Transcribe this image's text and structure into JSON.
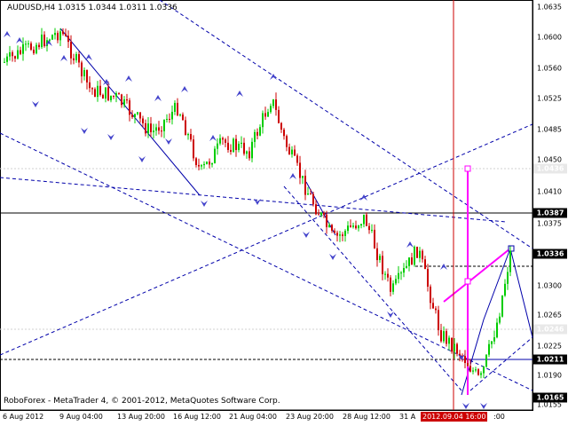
{
  "header": {
    "symbol_info": "AUDUSD,H4  1.0315 1.0344 1.0311 1.0336"
  },
  "footer": {
    "copyright": "RoboForex - MetaTrader 4, © 2001-2012, MetaQuotes Software Corp."
  },
  "price_axis": {
    "labels": [
      "1.0635",
      "1.0600",
      "1.0560",
      "1.0525",
      "1.0485",
      "1.0450",
      "1.0410",
      "1.0375",
      "1.0300",
      "1.0265",
      "1.0225",
      "1.0190",
      "1.0155"
    ],
    "tags": {
      "level_black": "1.0387",
      "current": "1.0336",
      "support": "1.0211",
      "low": "1.0165",
      "gray_upper": "1.0436",
      "gray_lower": "1.0246"
    }
  },
  "time_axis": {
    "labels": [
      "6 Aug 2012",
      "9 Aug 04:00",
      "13 Aug 20:00",
      "16 Aug 12:00",
      "21 Aug 04:00",
      "23 Aug 20:00",
      "28 Aug 12:00",
      "31 A"
    ],
    "highlight": "2012.09.04 16:00",
    "trailing": ":00"
  },
  "colors": {
    "bull_candle": "#00cc00",
    "bear_candle": "#cc0000",
    "trend_line": "#0000aa",
    "forecast": "#ff00ff",
    "cursor_line": "#cc0000"
  },
  "chart_data": {
    "type": "candlestick",
    "symbol": "AUDUSD",
    "timeframe": "H4",
    "last_bar": {
      "open": 1.0315,
      "high": 1.0344,
      "low": 1.0311,
      "close": 1.0336
    },
    "ylim": [
      1.0155,
      1.0635
    ]
  }
}
